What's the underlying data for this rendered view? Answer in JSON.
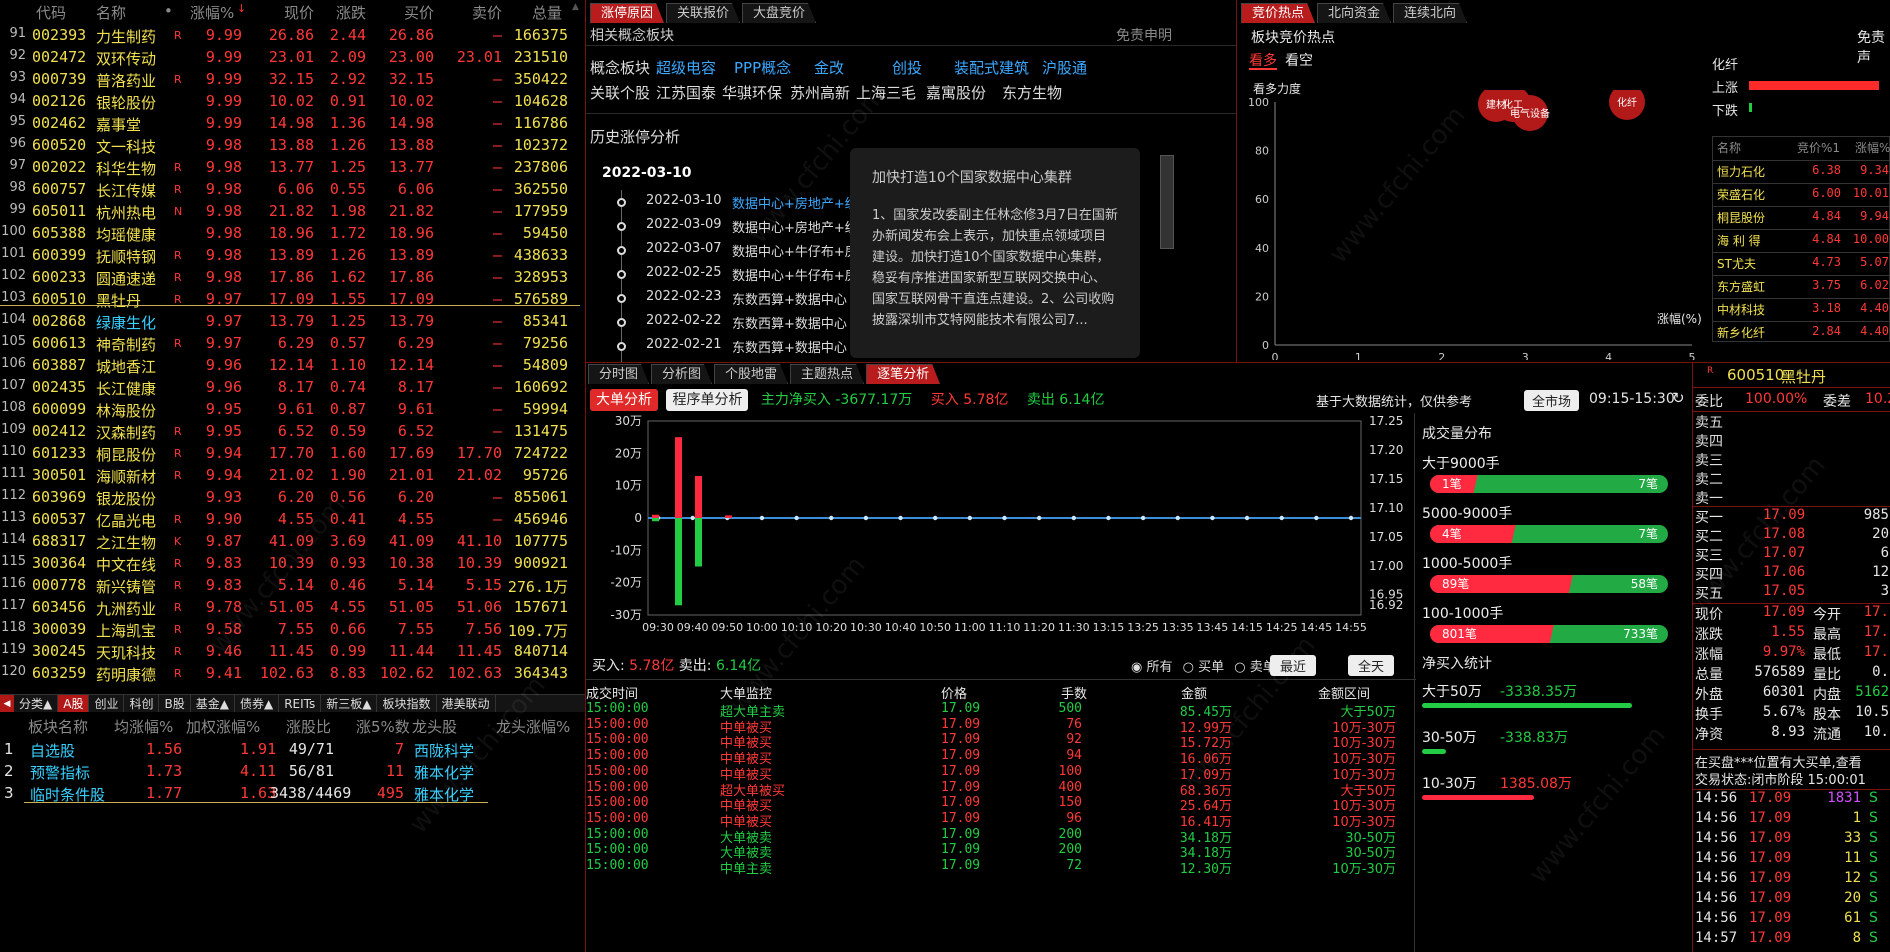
{
  "stock_list": {
    "headers": [
      "代码",
      "名称",
      "•",
      "涨幅%",
      "现价",
      "涨跌",
      "买价",
      "卖价",
      "总量"
    ],
    "rows": [
      [
        "91",
        "002393",
        "力生制药",
        "R",
        "9.99",
        "26.86",
        "2.44",
        "26.86",
        "—",
        "166375"
      ],
      [
        "92",
        "002472",
        "双环传动",
        "",
        "9.99",
        "23.01",
        "2.09",
        "23.00",
        "23.01",
        "231510"
      ],
      [
        "93",
        "000739",
        "普洛药业",
        "R",
        "9.99",
        "32.15",
        "2.92",
        "32.15",
        "—",
        "350422"
      ],
      [
        "94",
        "002126",
        "银轮股份",
        "",
        "9.99",
        "10.02",
        "0.91",
        "10.02",
        "—",
        "104628"
      ],
      [
        "95",
        "002462",
        "嘉事堂",
        "",
        "9.99",
        "14.98",
        "1.36",
        "14.98",
        "—",
        "116786"
      ],
      [
        "96",
        "600520",
        "文一科技",
        "",
        "9.98",
        "13.88",
        "1.26",
        "13.88",
        "—",
        "102372"
      ],
      [
        "97",
        "002022",
        "科华生物",
        "R",
        "9.98",
        "13.77",
        "1.25",
        "13.77",
        "—",
        "237806"
      ],
      [
        "98",
        "600757",
        "长江传媒",
        "R",
        "9.98",
        "6.06",
        "0.55",
        "6.06",
        "—",
        "362550"
      ],
      [
        "99",
        "605011",
        "杭州热电",
        "N",
        "9.98",
        "21.82",
        "1.98",
        "21.82",
        "—",
        "177959"
      ],
      [
        "100",
        "605388",
        "均瑶健康",
        "",
        "9.98",
        "18.96",
        "1.72",
        "18.96",
        "—",
        "59450"
      ],
      [
        "101",
        "600399",
        "抚顺特钢",
        "R",
        "9.98",
        "13.89",
        "1.26",
        "13.89",
        "—",
        "438633"
      ],
      [
        "102",
        "600233",
        "圆通速递",
        "R",
        "9.98",
        "17.86",
        "1.62",
        "17.86",
        "—",
        "328953"
      ],
      [
        "103",
        "600510",
        "黑牡丹",
        "R",
        "9.97",
        "17.09",
        "1.55",
        "17.09",
        "—",
        "576589"
      ],
      [
        "104",
        "002868",
        "绿康生化",
        "",
        "9.97",
        "13.79",
        "1.25",
        "13.79",
        "—",
        "85341"
      ],
      [
        "105",
        "600613",
        "神奇制药",
        "R",
        "9.97",
        "6.29",
        "0.57",
        "6.29",
        "—",
        "79256"
      ],
      [
        "106",
        "603887",
        "城地香江",
        "",
        "9.96",
        "12.14",
        "1.10",
        "12.14",
        "—",
        "54809"
      ],
      [
        "107",
        "002435",
        "长江健康",
        "",
        "9.96",
        "8.17",
        "0.74",
        "8.17",
        "—",
        "160692"
      ],
      [
        "108",
        "600099",
        "林海股份",
        "",
        "9.95",
        "9.61",
        "0.87",
        "9.61",
        "—",
        "59994"
      ],
      [
        "109",
        "002412",
        "汉森制药",
        "R",
        "9.95",
        "6.52",
        "0.59",
        "6.52",
        "—",
        "131475"
      ],
      [
        "110",
        "601233",
        "桐昆股份",
        "R",
        "9.94",
        "17.70",
        "1.60",
        "17.69",
        "17.70",
        "724722"
      ],
      [
        "111",
        "300501",
        "海顺新材",
        "R",
        "9.94",
        "21.02",
        "1.90",
        "21.01",
        "21.02",
        "95726"
      ],
      [
        "112",
        "603969",
        "银龙股份",
        "",
        "9.93",
        "6.20",
        "0.56",
        "6.20",
        "—",
        "855061"
      ],
      [
        "113",
        "600537",
        "亿晶光电",
        "R",
        "9.90",
        "4.55",
        "0.41",
        "4.55",
        "—",
        "456946"
      ],
      [
        "114",
        "688317",
        "之江生物",
        "K",
        "9.87",
        "41.09",
        "3.69",
        "41.09",
        "41.10",
        "107775"
      ],
      [
        "115",
        "300364",
        "中文在线",
        "R",
        "9.83",
        "10.39",
        "0.93",
        "10.38",
        "10.39",
        "900921"
      ],
      [
        "116",
        "000778",
        "新兴铸管",
        "R",
        "9.83",
        "5.14",
        "0.46",
        "5.14",
        "5.15",
        "276.1万"
      ],
      [
        "117",
        "603456",
        "九洲药业",
        "R",
        "9.78",
        "51.05",
        "4.55",
        "51.05",
        "51.06",
        "157671"
      ],
      [
        "118",
        "300039",
        "上海凯宝",
        "R",
        "9.58",
        "7.55",
        "0.66",
        "7.55",
        "7.56",
        "109.7万"
      ],
      [
        "119",
        "300245",
        "天玑科技",
        "R",
        "9.46",
        "11.45",
        "0.99",
        "11.44",
        "11.45",
        "840714"
      ],
      [
        "120",
        "603259",
        "药明康德",
        "R",
        "9.41",
        "102.63",
        "8.83",
        "102.62",
        "102.63",
        "364343"
      ]
    ]
  },
  "bottom_tabs": [
    "分类▲",
    "A股",
    "创业",
    "科创",
    "B股",
    "基金▲",
    "债券▲",
    "REITs",
    "新三板▲",
    "板块指数",
    "港美联动"
  ],
  "sector_table": {
    "headers": [
      "板块名称",
      "均涨幅%",
      "加权涨幅%",
      "涨股比",
      "涨5%数",
      "龙头股",
      "龙头涨幅%"
    ],
    "rows": [
      [
        "1",
        "自选股",
        "1.56",
        "1.91",
        "49/71",
        "7",
        "西陇科学"
      ],
      [
        "2",
        "预警指标",
        "1.73",
        "4.11",
        "56/81",
        "11",
        "雅本化学"
      ],
      [
        "3",
        "临时条件股",
        "1.77",
        "1.63",
        "3438/4469",
        "495",
        "雅本化学"
      ]
    ]
  },
  "top_center": {
    "tabs": [
      "涨停原因",
      "关联报价",
      "大盘竞价"
    ],
    "section_title": "相关概念板块",
    "disclaimer": "免责申明",
    "concept_label": "概念板块",
    "concepts": [
      "超级电容",
      "PPP概念",
      "金改",
      "创投",
      "装配式建筑",
      "沪股通"
    ],
    "related_label": "关联个股",
    "related": [
      "江苏国泰",
      "华骐环保",
      "苏州高新",
      "上海三毛",
      "嘉寓股份",
      "东方生物"
    ],
    "history_title": "历史涨停分析",
    "history_date": "2022-03-10",
    "history": [
      [
        "2022-03-10",
        "数据中心+房地产+纺"
      ],
      [
        "2022-03-09",
        "数据中心+房地产+纺"
      ],
      [
        "2022-03-07",
        "数据中心+牛仔布+房"
      ],
      [
        "2022-02-25",
        "数据中心+牛仔布+房"
      ],
      [
        "2022-02-23",
        "东数西算+数据中心"
      ],
      [
        "2022-02-22",
        "东数西算+数据中心"
      ],
      [
        "2022-02-21",
        "东数西算+数据中心"
      ]
    ],
    "popup_title": "加快打造10个国家数据中心集群",
    "popup_text": "1、国家发改委副主任林念修3月7日在国新办新闻发布会上表示，加快重点领域项目建设。加快打造10个国家数据中心集群，稳妥有序推进国家新型互联网交换中心、国家互联网骨干直连点建设。2、公司收购披露深圳市艾特网能技术有限公司7..."
  },
  "top_right": {
    "tabs": [
      "竞价热点",
      "北向资金",
      "连续北向"
    ],
    "title": "板块竞价热点",
    "right_title": "免责声",
    "toggle": [
      "看多",
      "看空"
    ],
    "ylabel": "看多力度",
    "xlabel": "涨幅(%)",
    "yticks": [
      "100",
      "80",
      "60",
      "40",
      "20",
      "0"
    ],
    "xticks": [
      "0",
      "1",
      "2",
      "3",
      "4",
      "5"
    ],
    "bubbles": [
      "建材",
      "化工",
      "电气设备",
      "化纤"
    ],
    "side_title": "化纤",
    "rise_label": "上涨",
    "fall_label": "下跌",
    "mini_headers": [
      "名称",
      "竞价%1",
      "涨幅%"
    ],
    "mini_rows": [
      [
        "恒力石化",
        "6.38",
        "9.34"
      ],
      [
        "荣盛石化",
        "6.00",
        "10.01"
      ],
      [
        "桐昆股份",
        "4.84",
        "9.94"
      ],
      [
        "海 利 得",
        "4.84",
        "10.00"
      ],
      [
        "ST尤夫",
        "4.73",
        "5.07"
      ],
      [
        "东方盛虹",
        "3.75",
        "6.02"
      ],
      [
        "中材科技",
        "3.18",
        "4.40"
      ],
      [
        "新乡化纤",
        "2.84",
        "4.40"
      ]
    ]
  },
  "mid_center": {
    "tabs": [
      "分时图",
      "分析图",
      "个股地雷",
      "主题热点",
      "逐笔分析"
    ],
    "btn_big": "大单分析",
    "btn_prog": "程序单分析",
    "net_buy_label": "主力净买入",
    "net_buy": "-3677.17万",
    "buy_label": "买入",
    "buy_val": "5.78亿",
    "sell_label": "卖出",
    "sell_val": "6.14亿",
    "note": "基于大数据统计，仅供参考",
    "market_btn": "全市场",
    "time_range": "09:15-15:30",
    "yleft": [
      "30万",
      "20万",
      "10万",
      "0",
      "-10万",
      "-20万",
      "-30万"
    ],
    "yright": [
      "17.25",
      "17.20",
      "17.15",
      "17.10",
      "17.05",
      "17.00",
      "16.95",
      "16.92"
    ],
    "xticks": [
      "09:30",
      "09:40",
      "09:50",
      "10:00",
      "10:10",
      "10:20",
      "10:30",
      "10:40",
      "10:50",
      "11:00",
      "11:10",
      "11:20",
      "11:30",
      "13:15",
      "13:25",
      "13:35",
      "13:45",
      "14:15",
      "14:25",
      "14:45",
      "14:55"
    ],
    "chart_buy_label": "买入:",
    "chart_buy": "5.78亿",
    "chart_sell_label": "卖出:",
    "chart_sell": "6.14亿",
    "radio": [
      "所有",
      "买单",
      "卖单"
    ],
    "btn_recent": "最近",
    "btn_all": "全天"
  },
  "chart_data": {
    "type": "bar",
    "xlabel": "",
    "ylabel": "",
    "ylim": [
      -300000,
      300000
    ],
    "series": [
      {
        "values": [
          {
            "t": "09:30",
            "buy": 10000,
            "sell": -10000
          },
          {
            "t": "09:34",
            "buy": 250000,
            "sell": -270000
          },
          {
            "t": "09:37",
            "buy": 130000,
            "sell": -150000
          },
          {
            "t": "09:45",
            "buy": 8000,
            "sell": 0
          }
        ]
      }
    ]
  },
  "volume_dist": {
    "title": "成交量分布",
    "items": [
      {
        "label": "大于9000手",
        "buy": "1笔",
        "sell": "7笔",
        "buy_frac": 0.2
      },
      {
        "label": "5000-9000手",
        "buy": "4笔",
        "sell": "7笔",
        "buy_frac": 0.36
      },
      {
        "label": "1000-5000手",
        "buy": "89笔",
        "sell": "58笔",
        "buy_frac": 0.6
      },
      {
        "label": "100-1000手",
        "buy": "801笔",
        "sell": "733笔",
        "buy_frac": 0.52
      }
    ],
    "net_title": "净买入统计",
    "net": [
      {
        "label": "大于50万",
        "val": "-3338.35万",
        "color": "green"
      },
      {
        "label": "30-50万",
        "val": "-338.83万",
        "color": "green"
      },
      {
        "label": "10-30万",
        "val": "1385.08万",
        "color": "red"
      }
    ]
  },
  "trades": {
    "headers": [
      "成交时间",
      "大单监控",
      "价格",
      "手数",
      "金额",
      "金额区间"
    ],
    "rows": [
      [
        "15:00:00",
        "超大单主卖",
        "17.09",
        "500",
        "85.45万",
        "大于50万",
        "g"
      ],
      [
        "15:00:00",
        "中单被买",
        "17.09",
        "76",
        "12.99万",
        "10万-30万",
        "r"
      ],
      [
        "15:00:00",
        "中单被买",
        "17.09",
        "92",
        "15.72万",
        "10万-30万",
        "r"
      ],
      [
        "15:00:00",
        "中单被买",
        "17.09",
        "94",
        "16.06万",
        "10万-30万",
        "r"
      ],
      [
        "15:00:00",
        "中单被买",
        "17.09",
        "100",
        "17.09万",
        "10万-30万",
        "r"
      ],
      [
        "15:00:00",
        "超大单被买",
        "17.09",
        "400",
        "68.36万",
        "大于50万",
        "r"
      ],
      [
        "15:00:00",
        "中单被买",
        "17.09",
        "150",
        "25.64万",
        "10万-30万",
        "r"
      ],
      [
        "15:00:00",
        "中单被买",
        "17.09",
        "96",
        "16.41万",
        "10万-30万",
        "r"
      ],
      [
        "15:00:00",
        "大单被卖",
        "17.09",
        "200",
        "34.18万",
        "30-50万",
        "g"
      ],
      [
        "15:00:00",
        "大单被卖",
        "17.09",
        "200",
        "34.18万",
        "30-50万",
        "g"
      ],
      [
        "15:00:00",
        "中单主卖",
        "17.09",
        "72",
        "12.30万",
        "10万-30万",
        "g"
      ]
    ]
  },
  "quote": {
    "code": "600510",
    "name": "黑牡丹",
    "badge": "R",
    "wb_label": "委比",
    "wb": "100.00%",
    "wc_label": "委差",
    "wc": "10.2",
    "sells": [
      "卖五",
      "卖四",
      "卖三",
      "卖二",
      "卖一"
    ],
    "buys": [
      [
        "买一",
        "17.09",
        "985"
      ],
      [
        "买二",
        "17.08",
        "20"
      ],
      [
        "买三",
        "17.07",
        "6"
      ],
      [
        "买四",
        "17.06",
        "12"
      ],
      [
        "买五",
        "17.05",
        "3"
      ]
    ],
    "stats": [
      [
        "现价",
        "17.09",
        "今开",
        "17."
      ],
      [
        "涨跌",
        "1.55",
        "最高",
        "17."
      ],
      [
        "涨幅",
        "9.97%",
        "最低",
        "17."
      ],
      [
        "总量",
        "576589",
        "量比",
        "0."
      ],
      [
        "外盘",
        "60301",
        "内盘",
        "5162"
      ],
      [
        "换手",
        "5.67%",
        "股本",
        "10.5"
      ],
      [
        "净资",
        "8.93",
        "流通",
        "10."
      ]
    ],
    "notice": "在买盘***位置有大买单,查看",
    "status": "交易状态:闭市阶段 15:00:01",
    "ticks": [
      [
        "14:56",
        "17.09",
        "1831",
        "S"
      ],
      [
        "14:56",
        "17.09",
        "1",
        "S"
      ],
      [
        "14:56",
        "17.09",
        "33",
        "S"
      ],
      [
        "14:56",
        "17.09",
        "11",
        "S"
      ],
      [
        "14:56",
        "17.09",
        "12",
        "S"
      ],
      [
        "14:56",
        "17.09",
        "20",
        "S"
      ],
      [
        "14:56",
        "17.09",
        "61",
        "S"
      ],
      [
        "14:57",
        "17.09",
        "8",
        "S"
      ]
    ]
  },
  "watermark": "www.cfchi.com"
}
